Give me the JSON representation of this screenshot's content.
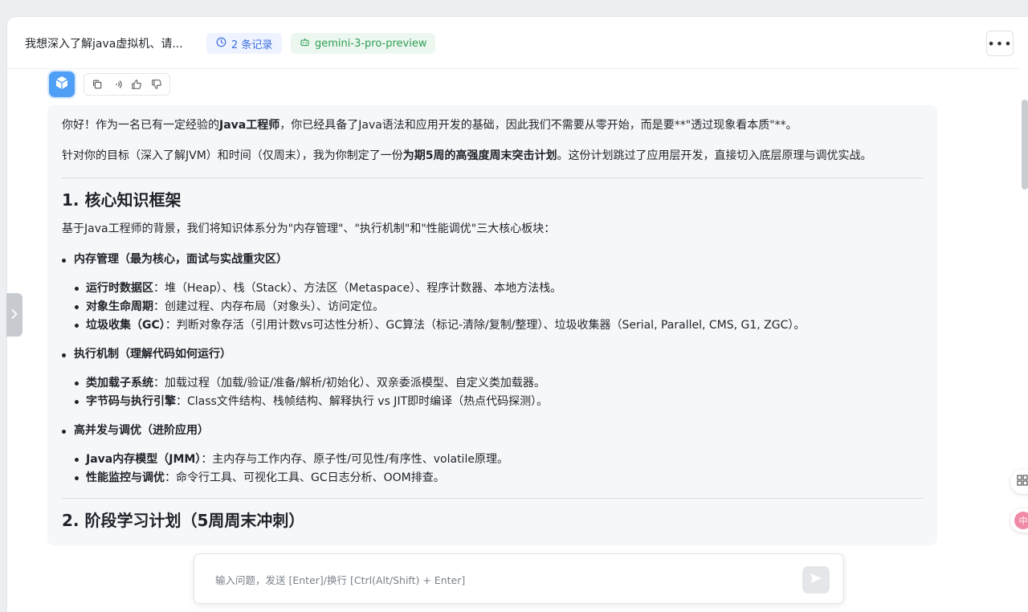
{
  "header": {
    "title": "我想深入了解java虚拟机、请...",
    "records_label": "2 条记录",
    "model_label": "gemini-3-pro-preview",
    "more_label": "•••"
  },
  "message": {
    "intro": {
      "pre": "你好！作为一名已有一定经验的",
      "strong": "Java工程师",
      "post": "，你已经具备了Java语法和应用开发的基础，因此我们不需要从零开始，而是要**\"透过现象看本质\"**。"
    },
    "plan": {
      "pre": "针对你的目标（深入了解JVM）和时间（仅周末），我为你制定了一份",
      "strong": "为期5周的高强度周末突击计划",
      "post": "。这份计划跳过了应用层开发，直接切入底层原理与调优实战。"
    },
    "section1": {
      "heading": "1. 核心知识框架",
      "intro": "基于Java工程师的背景，我们将知识体系分为\"内存管理\"、\"执行机制\"和\"性能调优\"三大核心板块：",
      "groups": [
        {
          "title": "内存管理（最为核心，面试与实战重灾区）",
          "items": [
            {
              "label": "运行时数据区",
              "text": "：堆（Heap）、栈（Stack）、方法区（Metaspace）、程序计数器、本地方法栈。"
            },
            {
              "label": "对象生命周期",
              "text": "：创建过程、内存布局（对象头）、访问定位。"
            },
            {
              "label": "垃圾收集（GC）",
              "text": "：判断对象存活（引用计数vs可达性分析）、GC算法（标记-清除/复制/整理）、垃圾收集器（Serial, Parallel, CMS, G1, ZGC）。"
            }
          ]
        },
        {
          "title": "执行机制（理解代码如何运行）",
          "items": [
            {
              "label": "类加载子系统",
              "text": "：加载过程（加载/验证/准备/解析/初始化）、双亲委派模型、自定义类加载器。"
            },
            {
              "label": "字节码与执行引擎",
              "text": "：Class文件结构、栈帧结构、解释执行 vs JIT即时编译（热点代码探测）。"
            }
          ]
        },
        {
          "title": "高并发与调优（进阶应用）",
          "items": [
            {
              "label": "Java内存模型（JMM）",
              "text": "：主内存与工作内存、原子性/可见性/有序性、volatile原理。"
            },
            {
              "label": "性能监控与调优",
              "text": "：命令行工具、可视化工具、GC日志分析、OOM排查。"
            }
          ]
        }
      ]
    },
    "section2": {
      "heading": "2. 阶段学习计划（5周周末冲刺）"
    }
  },
  "input": {
    "placeholder": "输入问题，发送 [Enter]/换行 [Ctrl(Alt/Shift) + Enter]"
  },
  "floating": {
    "badge_label": "中"
  },
  "icons": {
    "avatar": "cube-icon",
    "actions": [
      "copy-icon",
      "speaker-icon",
      "thumbs-up-icon",
      "thumbs-down-icon"
    ],
    "send": "send-icon",
    "toggle": "chevron-right-icon"
  },
  "colors": {
    "accent_blue": "#3b6fe0",
    "model_green": "#2e9e56",
    "avatar_blue": "#4e9ff5"
  }
}
